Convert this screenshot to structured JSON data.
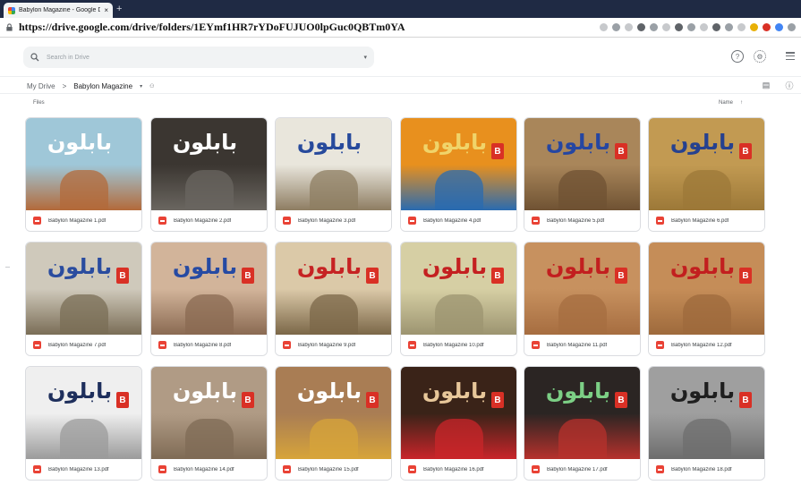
{
  "browser": {
    "tab_title": "Babylon Magazine - Google D",
    "tab_close": "×",
    "new_tab": "+",
    "url": "https://drive.google.com/drive/folders/1EYmf1HR7rYDoFUJUO0lpGuc0QBTm0YA"
  },
  "drive": {
    "search_placeholder": "Search in Drive",
    "breadcrumb": {
      "root": "My Drive",
      "separator": ">",
      "current": "Babylon Magazine"
    },
    "sort_left": "Files",
    "sort_right": "Name",
    "sort_arrow": "↑"
  },
  "colors": {
    "pdf_red": "#e94235",
    "tab_bar": "#1f2a44",
    "search_bg": "#f1f3f4"
  },
  "magazine_title_ar": "بابلون",
  "badge_glyph": "B",
  "files": [
    {
      "name": "Babylon Magazine 1.pdf",
      "bg": "#9fc7d8",
      "art": "#b36a3a",
      "title_color": "#ffffff",
      "badge": false
    },
    {
      "name": "Babylon Magazine 2.pdf",
      "bg": "#3b3631",
      "art": "#6a6660",
      "title_color": "#ffffff",
      "badge": false
    },
    {
      "name": "Babylon Magazine 3.pdf",
      "bg": "#e9e6dc",
      "art": "#8e7d62",
      "title_color": "#274a9c",
      "badge": false
    },
    {
      "name": "Babylon Magazine 4.pdf",
      "bg": "#e8901e",
      "art": "#2a6bb0",
      "title_color": "#f0d46a",
      "badge": true
    },
    {
      "name": "Babylon Magazine 5.pdf",
      "bg": "#a9865a",
      "art": "#6f5233",
      "title_color": "#2546a2",
      "badge": true
    },
    {
      "name": "Babylon Magazine 6.pdf",
      "bg": "#c29a52",
      "art": "#9c7838",
      "title_color": "#26418f",
      "badge": true
    },
    {
      "name": "Babylon Magazine 7.pdf",
      "bg": "#cfc9bb",
      "art": "#7a6d56",
      "title_color": "#2a4c9f",
      "badge": true
    },
    {
      "name": "Babylon Magazine 8.pdf",
      "bg": "#d2b49a",
      "art": "#8a6a52",
      "title_color": "#264aa3",
      "badge": true
    },
    {
      "name": "Babylon Magazine 9.pdf",
      "bg": "#dbc9a8",
      "art": "#7b6748",
      "title_color": "#c62323",
      "badge": true
    },
    {
      "name": "Babylon Magazine 10.pdf",
      "bg": "#d6cfa4",
      "art": "#9c9470",
      "title_color": "#c42020",
      "badge": true
    },
    {
      "name": "Babylon Magazine 11.pdf",
      "bg": "#c7915f",
      "art": "#a66d40",
      "title_color": "#c21f1f",
      "badge": true
    },
    {
      "name": "Babylon Magazine 12.pdf",
      "bg": "#c58d58",
      "art": "#9e6a3c",
      "title_color": "#c21f1f",
      "badge": true
    },
    {
      "name": "Babylon Magazine 13.pdf",
      "bg": "#efefef",
      "art": "#9b9b9b",
      "title_color": "#1e2f5c",
      "badge": true
    },
    {
      "name": "Babylon Magazine 14.pdf",
      "bg": "#b09b85",
      "art": "#7f6b55",
      "title_color": "#ffffff",
      "badge": true
    },
    {
      "name": "Babylon Magazine 15.pdf",
      "bg": "#a97d54",
      "art": "#d7a43a",
      "title_color": "#ffffff",
      "badge": true
    },
    {
      "name": "Babylon Magazine 16.pdf",
      "bg": "#3a2318",
      "art": "#c9252a",
      "title_color": "#e8c79a",
      "badge": true
    },
    {
      "name": "Babylon Magazine 17.pdf",
      "bg": "#2b2523",
      "art": "#b7312c",
      "title_color": "#7ccf85",
      "badge": true
    },
    {
      "name": "Babylon Magazine 18.pdf",
      "bg": "#9f9f9f",
      "art": "#6d6d6d",
      "title_color": "#1f1f1f",
      "badge": true
    }
  ]
}
